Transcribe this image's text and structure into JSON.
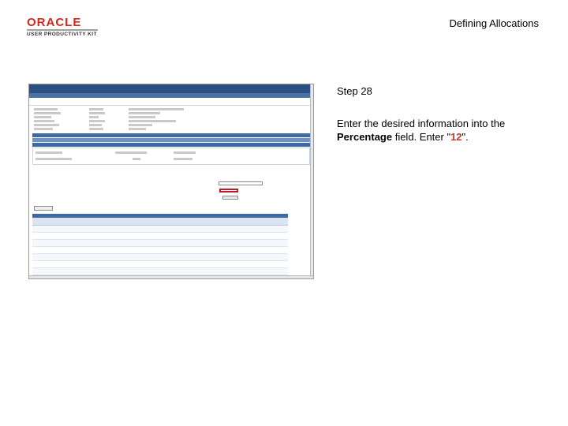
{
  "slide": {
    "title": "Defining Allocations",
    "logo_brand": "ORACLE",
    "logo_product": "USER PRODUCTIVITY KIT"
  },
  "step": {
    "label": "Step 28",
    "instruction_prefix": "Enter the desired information into the ",
    "field_name": "Percentage",
    "instruction_middle": " field. Enter \"",
    "value": "12",
    "instruction_suffix": "\"."
  },
  "colors": {
    "highlight": "#c0182a",
    "banner": "#2b4f82",
    "logo_red": "#d9261c"
  }
}
